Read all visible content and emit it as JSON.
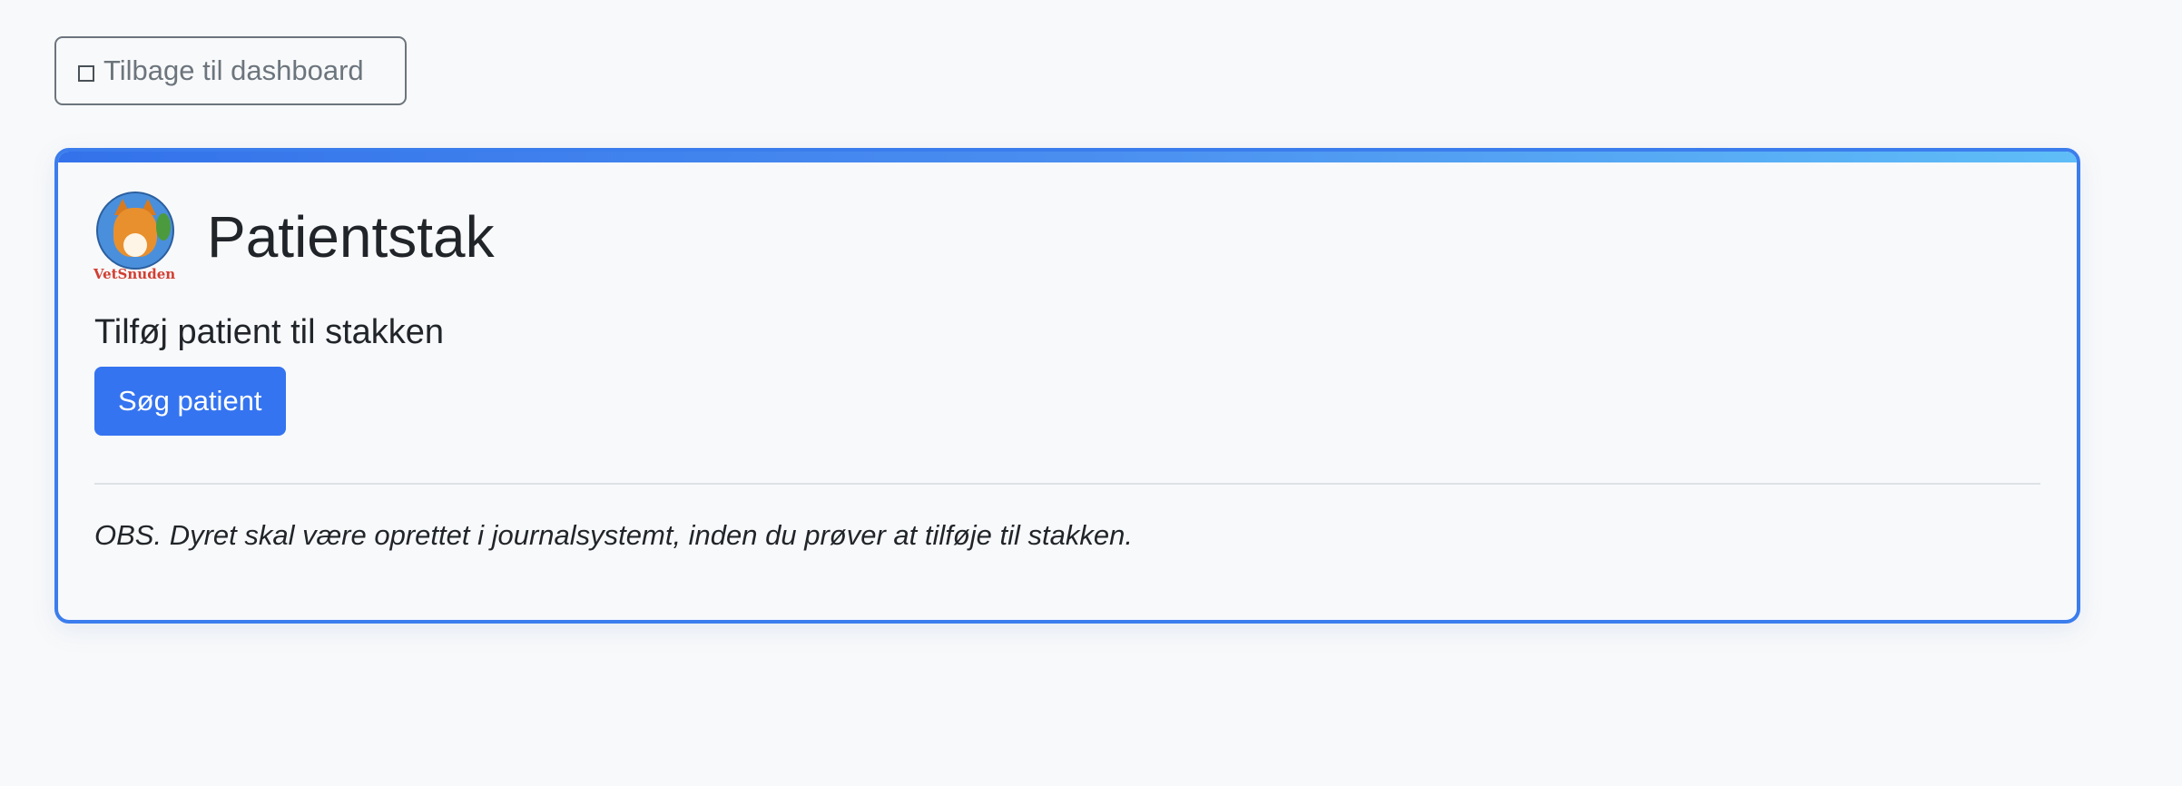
{
  "back_button": {
    "label": "Tilbage til dashboard",
    "icon": "square-outline-icon"
  },
  "card": {
    "accent_color": "#3b7ded",
    "logo": {
      "icon": "vetsnuden-logo-icon",
      "text": "VetSnuden"
    },
    "title": "Patientstak",
    "section_heading": "Tilføj patient til stakken",
    "search_button_label": "Søg patient",
    "note": "OBS. Dyret skal være oprettet i journalsystemt, inden du prøver at tilføje til stakken."
  },
  "colors": {
    "primary": "#3574f0",
    "secondary": "#6c757d",
    "background": "#f8f9fa",
    "logo_text": "#d23f32"
  }
}
